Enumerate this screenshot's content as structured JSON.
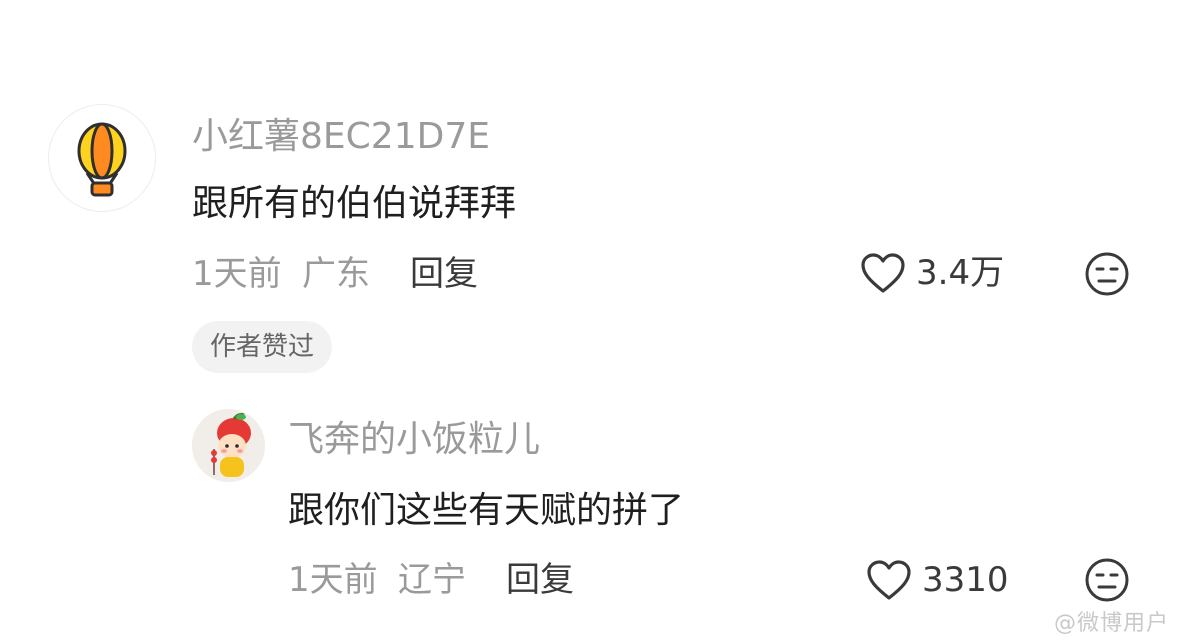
{
  "comment": {
    "username": "小红薯8EC21D7E",
    "text": "跟所有的伯伯说拜拜",
    "time": "1天前",
    "location": "广东",
    "reply_label": "回复",
    "likes": "3.4万",
    "badge": "作者赞过",
    "avatar_icon": "hot-air-balloon-icon"
  },
  "reply": {
    "username": "飞奔的小饭粒儿",
    "text": "跟你们这些有天赋的拼了",
    "time": "1天前",
    "location": "辽宁",
    "reply_label": "回复",
    "likes": "3310",
    "avatar_icon": "cartoon-doll-avatar"
  },
  "colors": {
    "meta_gray": "#9a9a9a",
    "text_dark": "#1f1f1f",
    "icon_dark": "#3a3a3a",
    "badge_bg": "#f2f2f2",
    "balloon_orange": "#ff8a1f",
    "balloon_yellow": "#ffd21f"
  },
  "watermark": "@微博用户"
}
